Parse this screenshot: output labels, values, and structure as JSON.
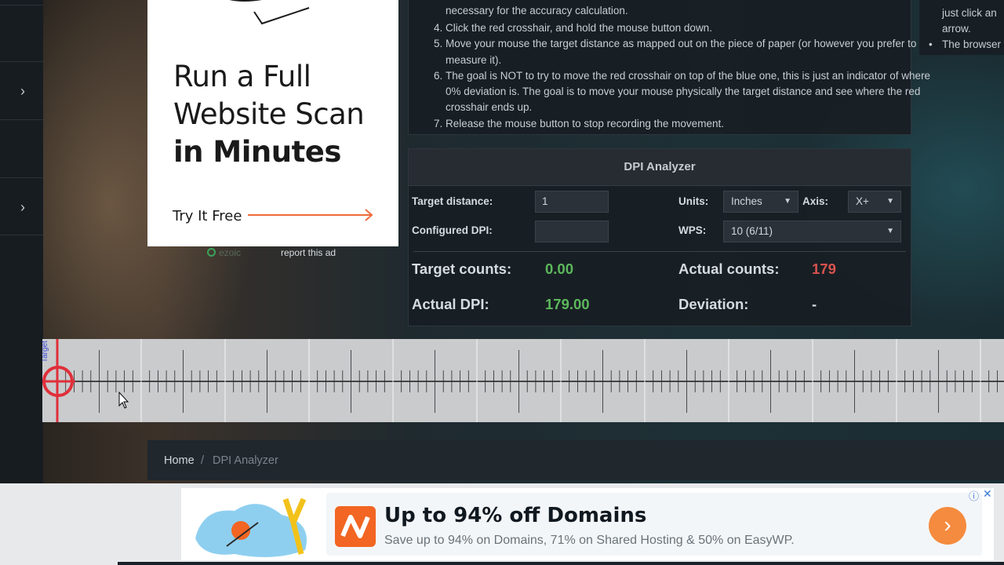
{
  "left_ad": {
    "line1": "Run a Full",
    "line2": "Website Scan",
    "line3": "in Minutes",
    "cta": "Try It Free",
    "ezoic": "ezoic",
    "report": "report this ad"
  },
  "instructions": {
    "continued": "necessary for the accuracy calculation.",
    "steps": [
      "Click the red crosshair, and hold the mouse button down.",
      "Move your mouse the target distance as mapped out on the piece of paper (or however you prefer to measure it).",
      "The goal is NOT to try to move the red crosshair on top of the blue one, this is just an indicator of where 0% deviation is. The goal is to move your mouse physically the target distance and see where the red crosshair ends up.",
      "Release the mouse button to stop recording the movement."
    ]
  },
  "right_snippet": {
    "line1": "just click an",
    "line2": "arrow.",
    "line3": "The browser"
  },
  "dpi": {
    "title": "DPI Analyzer",
    "target_distance_label": "Target distance:",
    "target_distance_value": "1",
    "configured_dpi_label": "Configured DPI:",
    "configured_dpi_value": "",
    "units_label": "Units:",
    "units_value": "Inches",
    "axis_label": "Axis:",
    "axis_value": "X+",
    "wps_label": "WPS:",
    "wps_value": "10 (6/11)",
    "target_counts_label": "Target counts:",
    "target_counts_value": "0.00",
    "actual_counts_label": "Actual counts:",
    "actual_counts_value": "179",
    "actual_dpi_label": "Actual DPI:",
    "actual_dpi_value": "179.00",
    "deviation_label": "Deviation:",
    "deviation_value": "-",
    "colors": {
      "green": "#5cb85c",
      "red": "#d9534f"
    }
  },
  "ruler": {
    "target_label": "Target"
  },
  "breadcrumb": {
    "home": "Home",
    "separator": "/",
    "current": "DPI Analyzer"
  },
  "bottom_ad": {
    "title": "Up to 94% off Domains",
    "subtitle": "Save up to 94% on Domains, 71% on Shared Hosting & 50% on EasyWP.",
    "info": "ⓘ",
    "close": "✕",
    "go": "›"
  },
  "icons": [
    "chevron-right-icon",
    "arrow-right-icon",
    "crosshair-icon",
    "cursor-icon",
    "info-icon",
    "close-icon",
    "chevron-down-icon"
  ]
}
